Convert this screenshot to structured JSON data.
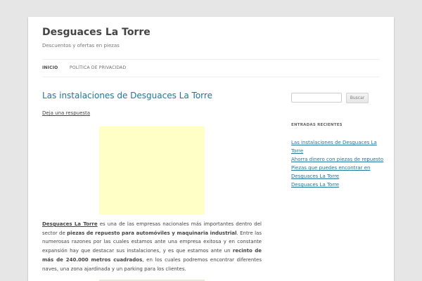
{
  "site": {
    "title": "Desguaces La Torre",
    "description": "Descuentos y ofertas en piezas"
  },
  "nav": {
    "items": [
      {
        "label": "INICIO",
        "current": true
      },
      {
        "label": "POLÍTICA DE PRIVACIDAD",
        "current": false
      }
    ]
  },
  "post": {
    "title": "Las instalaciones de Desguaces La Torre",
    "reply_link": "Deja una respuesta",
    "body": {
      "link_text": "Desguaces La Torre",
      "t1": " es una de las empresas nacionales más importantes dentro del sector  de ",
      "b1": "piezas de repuesto para automóviles y maquinaria industrial",
      "t2": ". Entre las numerosas razones por las cuales estamos ante una empresa exitosa y en constante expansión hay que destacar sus instalaciones, y es que estamos ante un ",
      "b2": "recinto de más de 240.000 metros cuadrados",
      "t3": ", en los cuales podremos encontrar diferentes naves, una zona ajardinada y un parking para los clientes."
    }
  },
  "sidebar": {
    "search": {
      "value": "",
      "button_label": "Buscar"
    },
    "recent": {
      "title": "ENTRADAS RECIENTES",
      "items": [
        "Las instalaciones de Desguaces La Torre",
        "Ahorra dinero con piezas de repuesto",
        "Piezas que puedes encontrar en Desguaces La Torre",
        "Desguaces La Torre"
      ]
    }
  },
  "colors": {
    "link": "#21759b",
    "ad_placeholder": "#ffffc6",
    "background": "#e6e6e6"
  }
}
